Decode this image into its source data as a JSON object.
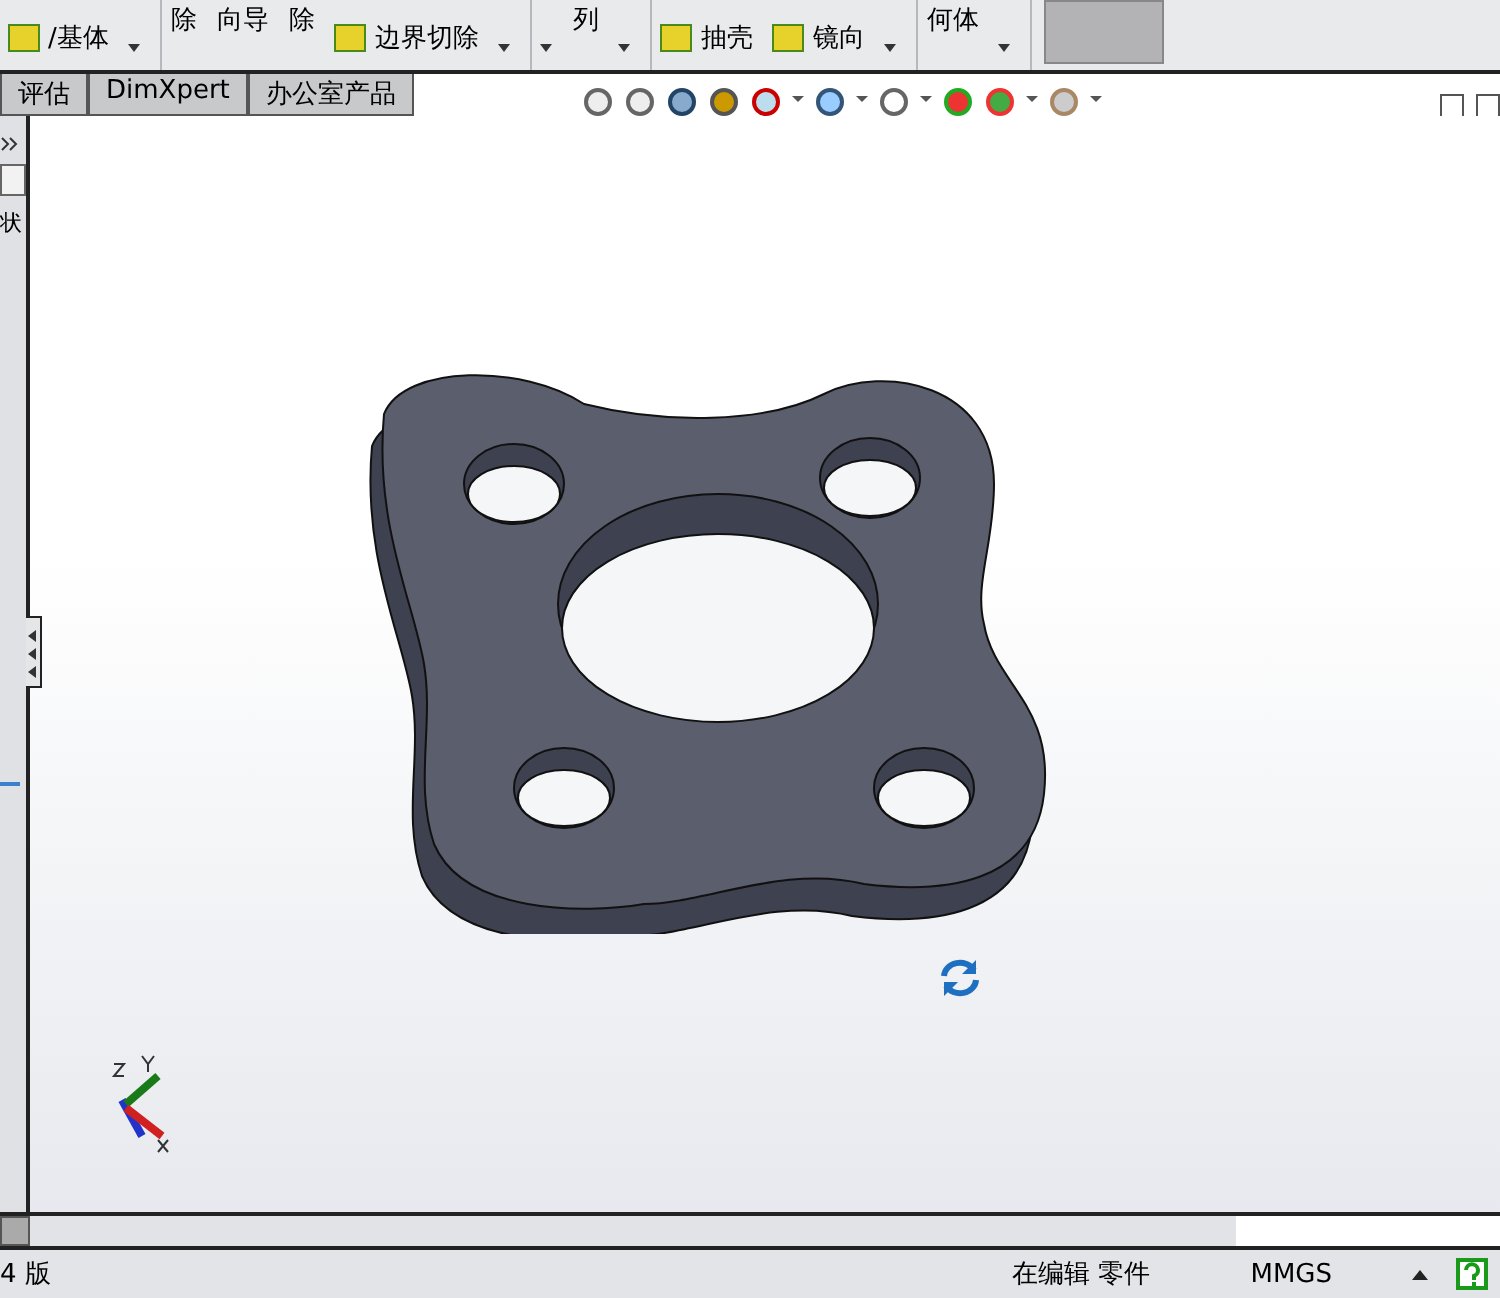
{
  "ribbon": [
    {
      "items": [
        {
          "kind": "small",
          "text": "/基体"
        }
      ]
    },
    {
      "items": [
        {
          "kind": "big",
          "text": "除"
        },
        {
          "kind": "big",
          "text": "向导"
        },
        {
          "kind": "big",
          "text": "除"
        },
        {
          "kind": "small",
          "text": "边界切除"
        }
      ]
    },
    {
      "items": [
        {
          "kind": "arrow"
        },
        {
          "kind": "big",
          "text": "列"
        }
      ]
    },
    {
      "items": [
        {
          "kind": "small",
          "text": "抽壳"
        },
        {
          "kind": "small",
          "text": "镜向"
        }
      ]
    },
    {
      "items": [
        {
          "kind": "big",
          "text": "何体"
        }
      ]
    }
  ],
  "tabs": [
    {
      "label": "评估",
      "selected": false
    },
    {
      "label": "DimXpert",
      "selected": false
    },
    {
      "label": "办公室产品",
      "selected": false
    }
  ],
  "side_panel": {
    "text": "状"
  },
  "status_bar": {
    "left": "4 版",
    "mode": "在编辑 零件",
    "units": "MMGS"
  }
}
